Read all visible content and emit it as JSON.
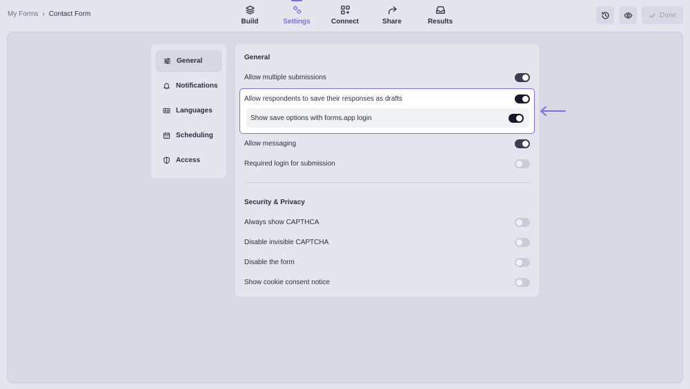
{
  "header": {
    "breadcrumb": {
      "root": "My Forms",
      "separator": "›",
      "current": "Contact Form"
    },
    "tabs": [
      {
        "label": "Build",
        "icon": "layers-icon"
      },
      {
        "label": "Settings",
        "icon": "gears-icon",
        "active": true
      },
      {
        "label": "Connect",
        "icon": "grid-plus-icon"
      },
      {
        "label": "Share",
        "icon": "share-arrow-icon"
      },
      {
        "label": "Results",
        "icon": "inbox-icon"
      }
    ],
    "done_label": "Done"
  },
  "sidebar": {
    "items": [
      {
        "label": "General",
        "icon": "sliders-icon",
        "active": true
      },
      {
        "label": "Notifications",
        "icon": "bell-icon"
      },
      {
        "label": "Languages",
        "icon": "language-icon"
      },
      {
        "label": "Scheduling",
        "icon": "calendar-icon"
      },
      {
        "label": "Access",
        "icon": "shield-icon"
      }
    ]
  },
  "general": {
    "title": "General",
    "settings": [
      {
        "label": "Allow multiple submissions",
        "enabled": true
      },
      {
        "label": "Allow respondents to save their responses as drafts",
        "enabled": true
      },
      {
        "label": "Show save options with forms.app login",
        "enabled": true
      },
      {
        "label": "Allow messaging",
        "enabled": true
      },
      {
        "label": "Required login for submission",
        "enabled": false
      }
    ]
  },
  "security": {
    "title": "Security & Privacy",
    "settings": [
      {
        "label": "Always show CAPTHCA",
        "enabled": false
      },
      {
        "label": "Disable invisible CAPTCHA",
        "enabled": false
      },
      {
        "label": "Disable the form",
        "enabled": false
      },
      {
        "label": "Show cookie consent notice",
        "enabled": false
      }
    ]
  },
  "colors": {
    "accent": "#7c6fe0",
    "toggle_on": "#3a3f52",
    "toggle_off": "#c9ccd6"
  }
}
